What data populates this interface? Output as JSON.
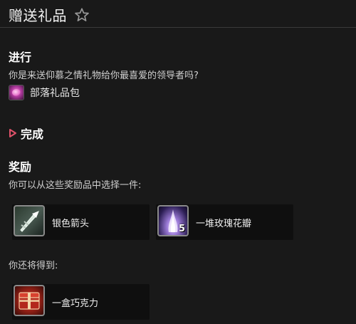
{
  "header": {
    "title": "赠送礼品",
    "favorite_icon": "star-outline-icon"
  },
  "progress": {
    "heading": "进行",
    "text": "你是来送仰慕之情礼物给你最喜爱的领导者吗?",
    "item": {
      "label": "部落礼品包",
      "icon": "gift-bag-icon"
    }
  },
  "completion": {
    "label": "完成",
    "icon": "expand-triangle-icon"
  },
  "rewards": {
    "heading": "奖励",
    "choose_text": "你可以从这些奖励品中选择一件:",
    "choices": [
      {
        "name": "银色箭头",
        "icon": "silver-arrowhead-icon",
        "quantity": ""
      },
      {
        "name": "一堆玫瑰花瓣",
        "icon": "rose-petals-icon",
        "quantity": "5"
      }
    ],
    "also_text": "你还将得到:",
    "also": [
      {
        "name": "一盒巧克力",
        "icon": "chocolate-box-icon",
        "quantity": ""
      }
    ]
  },
  "colors": {
    "background": "#191919",
    "card": "#0f0f0f",
    "triangle": "#e0526a"
  }
}
